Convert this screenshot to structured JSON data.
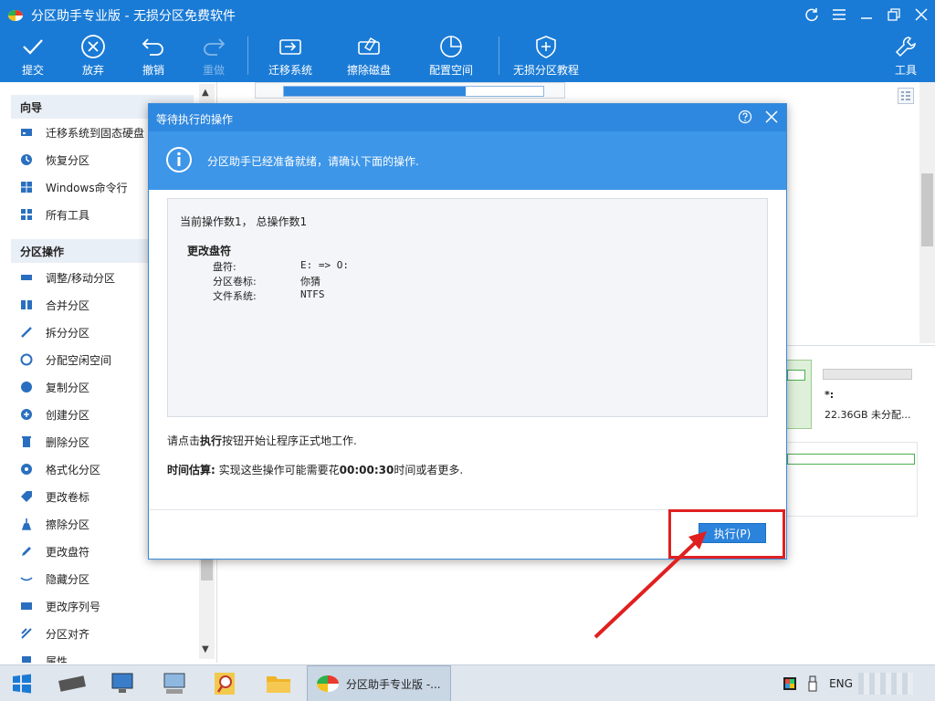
{
  "window": {
    "title": "分区助手专业版 - 无损分区免费软件"
  },
  "toolbar": {
    "items": [
      {
        "label": "提交",
        "icon": "check-icon"
      },
      {
        "label": "放弃",
        "icon": "cancel-circle-icon"
      },
      {
        "label": "撤销",
        "icon": "undo-icon"
      },
      {
        "label": "重做",
        "icon": "redo-icon"
      },
      {
        "label": "迁移系统",
        "icon": "migrate-disk-icon"
      },
      {
        "label": "擦除磁盘",
        "icon": "erase-disk-icon"
      },
      {
        "label": "配置空间",
        "icon": "pie-chart-icon"
      },
      {
        "label": "无损分区教程",
        "icon": "shield-icon"
      },
      {
        "label": "工具",
        "icon": "wrench-icon"
      }
    ]
  },
  "sidebar": {
    "wizard_title": "向导",
    "wizard_items": [
      "迁移系统到固态硬盘",
      "恢复分区",
      "Windows命令行",
      "所有工具"
    ],
    "ops_title": "分区操作",
    "ops_items": [
      "调整/移动分区",
      "合并分区",
      "拆分分区",
      "分配空闲空间",
      "复制分区",
      "创建分区",
      "删除分区",
      "格式化分区",
      "更改卷标",
      "擦除分区",
      "更改盘符",
      "隐藏分区",
      "更改序列号",
      "分区对齐",
      "属性"
    ]
  },
  "main": {
    "partition_star": "*:",
    "partition_info": "22.36GB 未分配..."
  },
  "dialog": {
    "title": "等待执行的操作",
    "info_text": "分区助手已经准备就绪，请确认下面的操作.",
    "count_line": "当前操作数1， 总操作数1",
    "op_title": "更改盘符",
    "details": [
      {
        "label": "盘符:",
        "value": "E: => O:"
      },
      {
        "label": "分区卷标:",
        "value": "你猜"
      },
      {
        "label": "文件系统:",
        "value": "NTFS"
      }
    ],
    "instruction_prefix": "请点击",
    "instruction_bold": "执行",
    "instruction_suffix": "按钮开始让程序正式地工作.",
    "time_label": "时间估算:",
    "time_prefix": "实现这些操作可能需要花",
    "time_value": "00:00:30",
    "time_suffix": "时间或者更多.",
    "execute_label": "执行(P)"
  },
  "taskbar": {
    "active_app": "分区助手专业版 -...",
    "lang": "ENG"
  },
  "colors": {
    "titlebar": "#1a7bd6",
    "dialog_header": "#2f88df",
    "highlight": "#e02020"
  }
}
